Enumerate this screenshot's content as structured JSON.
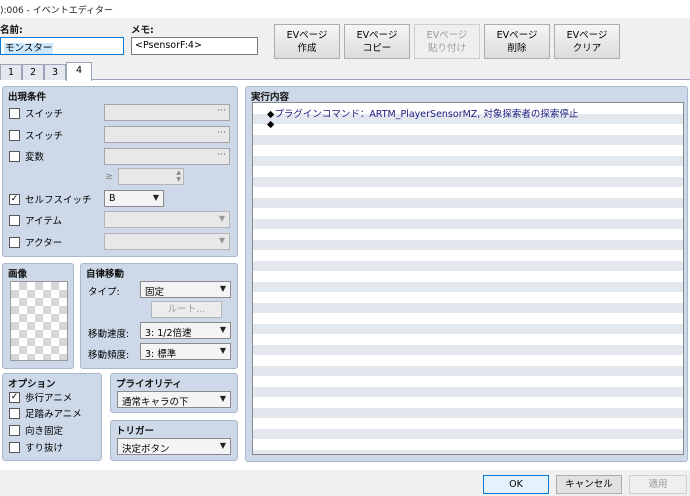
{
  "window": {
    "title": "):006 - イベントエディター"
  },
  "top": {
    "name_label": "名前:",
    "name_value": "モンスター",
    "memo_label": "メモ:",
    "memo_value": "<PsensorF:4>"
  },
  "ev_buttons": [
    {
      "line1": "EVページ",
      "line2": "作成",
      "enabled": true
    },
    {
      "line1": "EVページ",
      "line2": "コピー",
      "enabled": true
    },
    {
      "line1": "EVページ",
      "line2": "貼り付け",
      "enabled": false
    },
    {
      "line1": "EVページ",
      "line2": "削除",
      "enabled": true
    },
    {
      "line1": "EVページ",
      "line2": "クリア",
      "enabled": true
    }
  ],
  "tabs": [
    "1",
    "2",
    "3",
    "4"
  ],
  "active_tab": "4",
  "conditions": {
    "title": "出現条件",
    "switch1": {
      "label": "スイッチ",
      "checked": false,
      "dots": "···"
    },
    "switch2": {
      "label": "スイッチ",
      "checked": false,
      "dots": "···"
    },
    "variable": {
      "label": "変数",
      "checked": false,
      "dots": "···",
      "ge": "≥"
    },
    "self_switch": {
      "label": "セルフスイッチ",
      "checked": true,
      "value": "B"
    },
    "item": {
      "label": "アイテム",
      "checked": false
    },
    "actor": {
      "label": "アクター",
      "checked": false
    }
  },
  "image": {
    "title": "画像"
  },
  "autonomous": {
    "title": "自律移動",
    "type_label": "タイプ:",
    "type_value": "固定",
    "route_label": "ルート...",
    "speed_label": "移動速度:",
    "speed_value": "3: 1/2倍速",
    "freq_label": "移動頻度:",
    "freq_value": "3: 標準"
  },
  "options": {
    "title": "オプション",
    "walking": {
      "label": "歩行アニメ",
      "checked": true
    },
    "stepping": {
      "label": "足踏みアニメ",
      "checked": false
    },
    "direction_fix": {
      "label": "向き固定",
      "checked": false
    },
    "through": {
      "label": "すり抜け",
      "checked": false
    }
  },
  "priority": {
    "title": "プライオリティ",
    "value": "通常キャラの下"
  },
  "trigger": {
    "title": "トリガー",
    "value": "決定ボタン"
  },
  "contents": {
    "title": "実行内容",
    "lines": [
      {
        "bullet": "◆",
        "text": "プラグインコマンド：ARTM_PlayerSensorMZ, 対象探索者の探索停止"
      },
      {
        "bullet": "◆",
        "text": ""
      }
    ]
  },
  "footer": {
    "ok": "OK",
    "cancel": "キャンセル",
    "apply": "適用"
  },
  "colors": {
    "panel_bg": "#cdd9e8",
    "stripe": "#e3e8ef",
    "command_text": "#1a1a80"
  }
}
